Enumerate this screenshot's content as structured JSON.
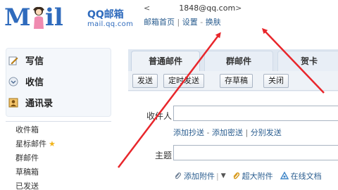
{
  "header": {
    "logo_m": "M",
    "logo_il": "il",
    "logo_cn": "QQ邮箱",
    "logo_url": "mail.qq.com",
    "email_open": "<",
    "email": "1848@qq.com",
    "email_close": ">",
    "links": [
      "邮箱首页",
      "设置",
      "换肤"
    ],
    "link_sep": "|",
    "link_sep2": "-"
  },
  "sidebar": {
    "main_items": [
      {
        "label": "写信",
        "icon": "pencil-icon"
      },
      {
        "label": "收信",
        "icon": "inbox-icon"
      },
      {
        "label": "通讯录",
        "icon": "contacts-icon"
      }
    ],
    "folders": [
      "收件箱",
      "星标邮件",
      "群邮件",
      "草稿箱",
      "已发送"
    ],
    "star_glyph": "★"
  },
  "main": {
    "tabs": [
      "普通邮件",
      "群邮件",
      "贺卡"
    ],
    "toolbar": [
      "发送",
      "定时发送",
      "存草稿",
      "关闭"
    ],
    "recipient_label": "收件人",
    "cc_links": [
      "添加抄送",
      "添加密送",
      "分别发送"
    ],
    "cc_sep1": "-",
    "cc_sep2": "|",
    "subject_label": "主题",
    "attachments": [
      "添加附件",
      "超大附件",
      "在线文档"
    ],
    "dropdown_glyph": "▼",
    "bar_glyph": "|"
  },
  "colors": {
    "brand": "#2f6bbd",
    "link": "#2a5d8f",
    "arrow": "#e8262b"
  }
}
